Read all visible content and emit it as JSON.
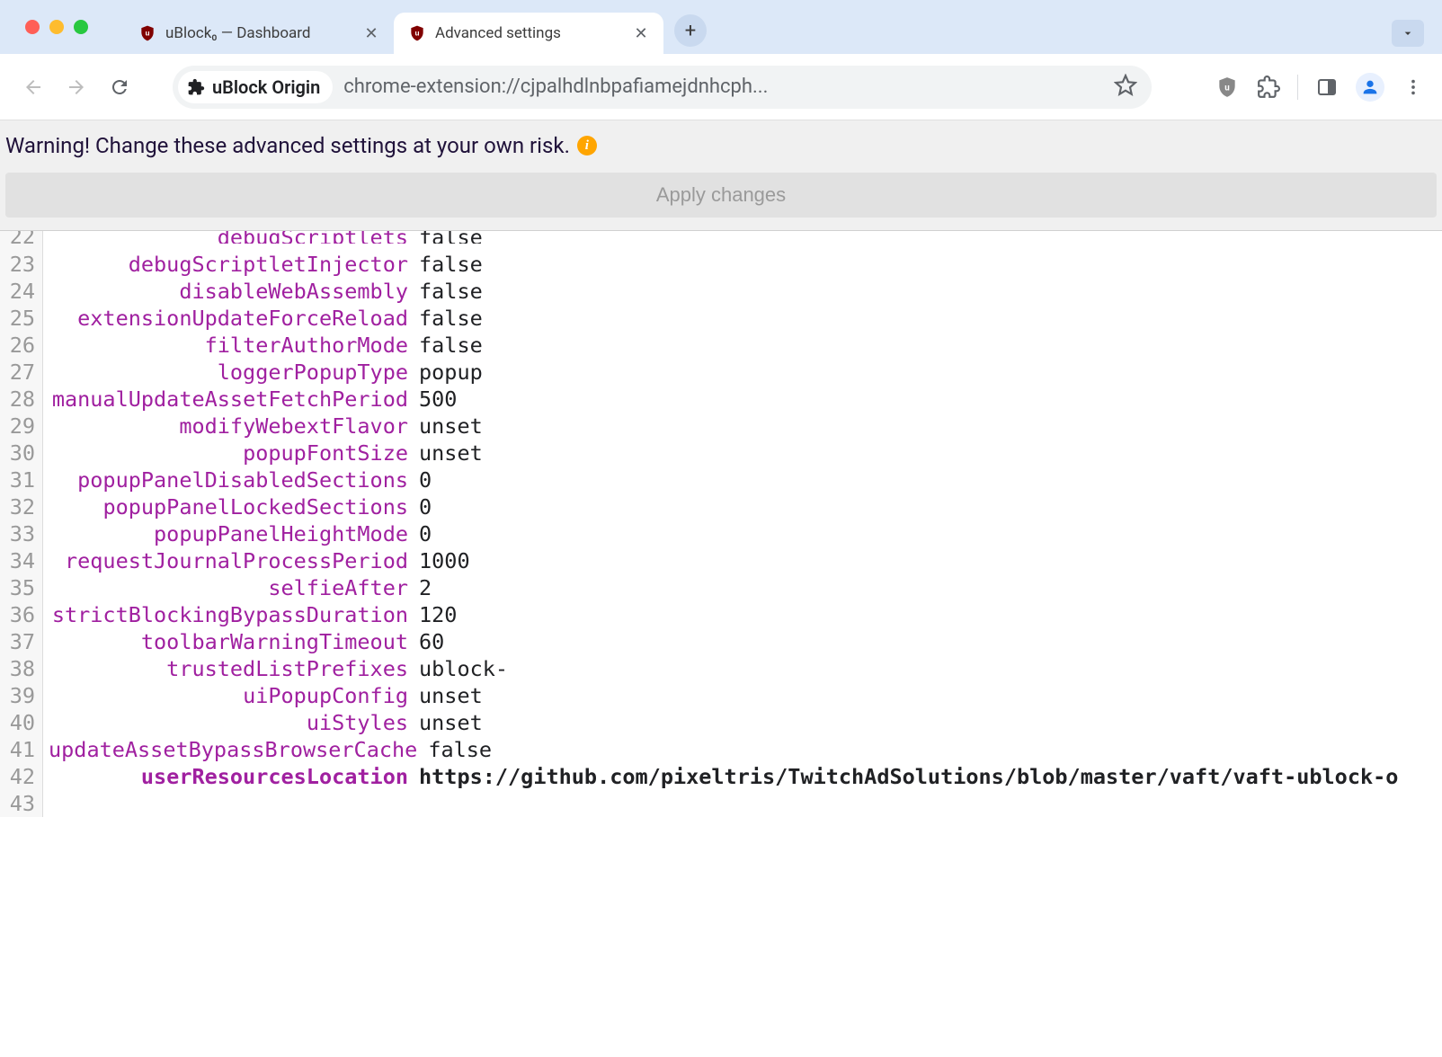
{
  "browser": {
    "tabs": [
      {
        "title": "uBlock₀ — Dashboard",
        "active": false
      },
      {
        "title": "Advanced settings",
        "active": true
      }
    ],
    "addressChip": "uBlock Origin",
    "url": "chrome-extension://cjpalhdlnbpafiamejdnhcph..."
  },
  "page": {
    "warning": "Warning! Change these advanced settings at your own risk.",
    "applyLabel": "Apply changes"
  },
  "editor": {
    "startLine": 22,
    "activeIndex": 20,
    "lines": [
      {
        "key": "debugScriptlets",
        "val": "false"
      },
      {
        "key": "debugScriptletInjector",
        "val": "false"
      },
      {
        "key": "disableWebAssembly",
        "val": "false"
      },
      {
        "key": "extensionUpdateForceReload",
        "val": "false"
      },
      {
        "key": "filterAuthorMode",
        "val": "false"
      },
      {
        "key": "loggerPopupType",
        "val": "popup"
      },
      {
        "key": "manualUpdateAssetFetchPeriod",
        "val": "500"
      },
      {
        "key": "modifyWebextFlavor",
        "val": "unset"
      },
      {
        "key": "popupFontSize",
        "val": "unset"
      },
      {
        "key": "popupPanelDisabledSections",
        "val": "0"
      },
      {
        "key": "popupPanelLockedSections",
        "val": "0"
      },
      {
        "key": "popupPanelHeightMode",
        "val": "0"
      },
      {
        "key": "requestJournalProcessPeriod",
        "val": "1000"
      },
      {
        "key": "selfieAfter",
        "val": "2"
      },
      {
        "key": "strictBlockingBypassDuration",
        "val": "120"
      },
      {
        "key": "toolbarWarningTimeout",
        "val": "60"
      },
      {
        "key": "trustedListPrefixes",
        "val": "ublock-"
      },
      {
        "key": "uiPopupConfig",
        "val": "unset"
      },
      {
        "key": "uiStyles",
        "val": "unset"
      },
      {
        "key": "updateAssetBypassBrowserCache",
        "val": "false"
      },
      {
        "key": "userResourcesLocation",
        "val": "https://github.com/pixeltris/TwitchAdSolutions/blob/master/vaft/vaft-ublock-o"
      },
      {
        "key": "",
        "val": ""
      }
    ]
  }
}
